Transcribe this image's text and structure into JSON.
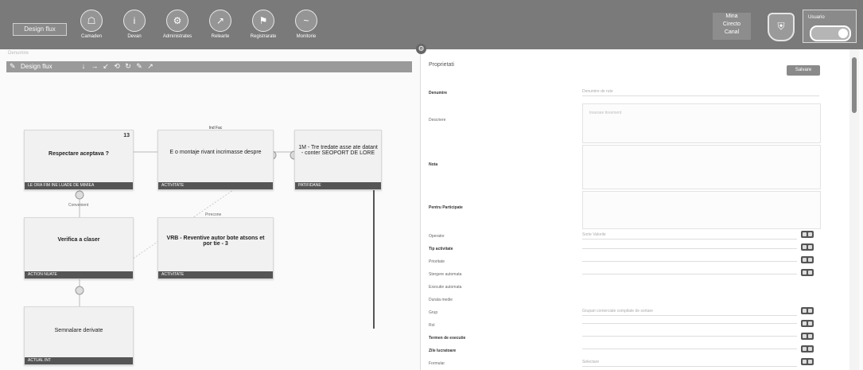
{
  "header": {
    "nav": [
      {
        "label": "Camaden",
        "icon": "home-icon",
        "glyph": "☖"
      },
      {
        "label": "Devan",
        "icon": "info-icon",
        "glyph": "i"
      },
      {
        "label": "Administrates",
        "icon": "gear-icon",
        "glyph": "⚙"
      },
      {
        "label": "Relearte",
        "icon": "chart-icon",
        "glyph": "↗"
      },
      {
        "label": "Registrarate",
        "icon": "flag-icon",
        "glyph": "⚑"
      },
      {
        "label": "Monitorie",
        "icon": "pulse-icon",
        "glyph": "~"
      }
    ],
    "brand_lines": [
      "Mina",
      "Cirecto",
      "Canal"
    ],
    "user_label": "Usuario"
  },
  "toolbar": {
    "title": "Design flux",
    "tools": [
      "↓",
      "→",
      "↙",
      "⟲",
      "↻",
      "✎",
      "↗"
    ]
  },
  "canvas": {
    "cards": [
      {
        "title": "Respectare aceptava ?",
        "head": "",
        "number": "13",
        "footer": "LE ORA FIM INE LUADE DE MIMIEA"
      },
      {
        "title": "E o montaje rivant incrimasse despre",
        "head": "Ind Fac",
        "number": "",
        "footer": "ACTIVITATE"
      },
      {
        "title": "1M - Tre tredate asse ate datant - conter SEOPORT DE LORE",
        "head": "",
        "number": "",
        "footer": "PATIFIDANE"
      },
      {
        "title": "Verifica a claser",
        "head": "",
        "number": "",
        "footer": "ACTION NUATE"
      },
      {
        "title": "VRB - Reventive autor bote atsons et por tie - 3",
        "head": "",
        "number": "",
        "footer": "ACTIVITATE"
      },
      {
        "title": "Semnalare derivate",
        "head": "",
        "number": "",
        "footer": "ACTUAL INT"
      }
    ],
    "link_labels": [
      "Convenient",
      "Prrecone"
    ]
  },
  "panel": {
    "title": "Proprietati",
    "save_label": "Salvare",
    "rows": [
      {
        "label": "Denumire",
        "bold": true
      },
      {
        "label": "Descriere",
        "bold": false
      },
      {
        "label": "Nota",
        "bold": true
      },
      {
        "label": "Pentru Participate",
        "bold": true
      },
      {
        "label": "Operator",
        "bold": false
      },
      {
        "label": "Tip activitate",
        "bold": true
      },
      {
        "label": "Prioritate",
        "bold": false
      },
      {
        "label": "Stergere automata",
        "bold": false
      },
      {
        "label": "Executie automata",
        "bold": false
      },
      {
        "label": "Durata medie",
        "bold": false
      },
      {
        "label": "Grup",
        "bold": false
      },
      {
        "label": "Rol",
        "bold": false
      },
      {
        "label": "Termen de executie",
        "bold": true
      },
      {
        "label": "Zile lucratoare",
        "bold": true
      },
      {
        "label": "Formular",
        "bold": false
      }
    ],
    "placeholders": {
      "name": "Denumire de rute",
      "desc": "Inserare tiresment",
      "operator": "Sorte Valorile",
      "group": "Grupari comerciale compilate de sortare",
      "form": "Selectare"
    }
  }
}
